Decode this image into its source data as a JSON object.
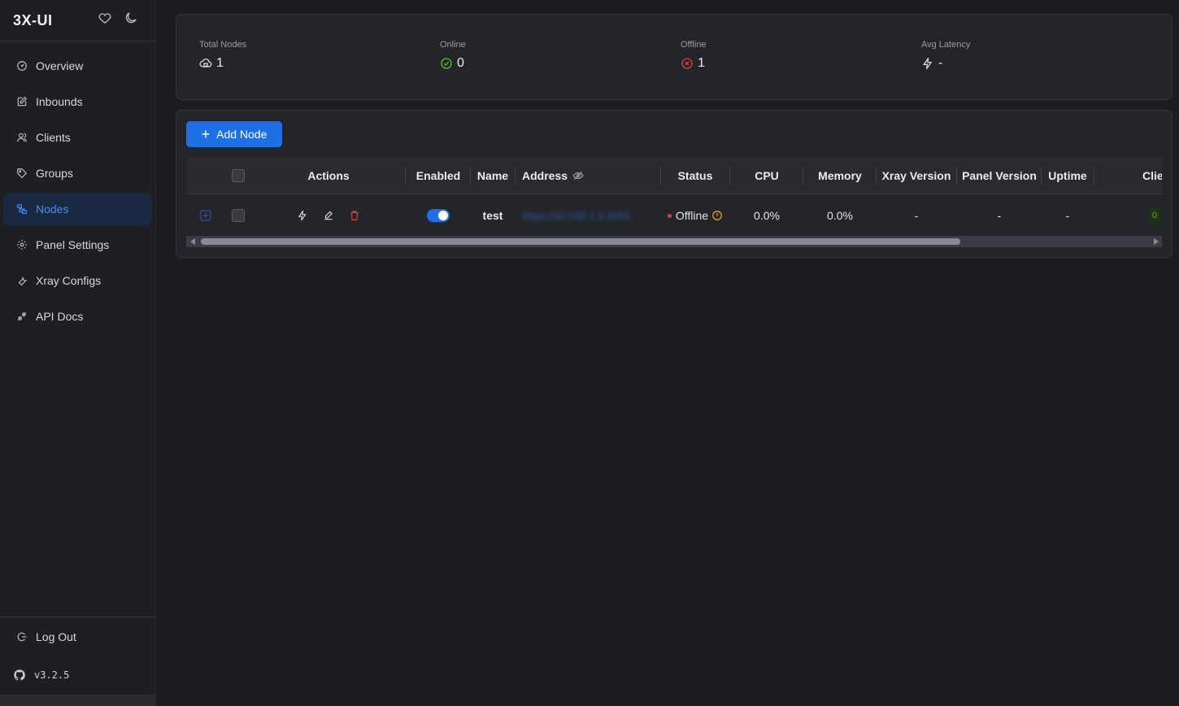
{
  "brand": {
    "title": "3X-UI",
    "heart_icon": "heart-icon",
    "theme_icon": "moon-icon"
  },
  "sidebar": {
    "items": [
      {
        "label": "Overview",
        "icon": "dashboard-icon",
        "active": false
      },
      {
        "label": "Inbounds",
        "icon": "edit-square-icon",
        "active": false
      },
      {
        "label": "Clients",
        "icon": "users-icon",
        "active": false
      },
      {
        "label": "Groups",
        "icon": "tag-icon",
        "active": false
      },
      {
        "label": "Nodes",
        "icon": "cluster-icon",
        "active": true
      },
      {
        "label": "Panel Settings",
        "icon": "gear-icon",
        "active": false
      },
      {
        "label": "Xray Configs",
        "icon": "wrench-icon",
        "active": false
      },
      {
        "label": "API Docs",
        "icon": "api-icon",
        "active": false
      }
    ],
    "logout_label": "Log Out",
    "version": "v3.2.5"
  },
  "stats": {
    "total_nodes": {
      "label": "Total Nodes",
      "value": "1"
    },
    "online": {
      "label": "Online",
      "value": "0"
    },
    "offline": {
      "label": "Offline",
      "value": "1"
    },
    "avg_latency": {
      "label": "Avg Latency",
      "value": "-"
    }
  },
  "nodes": {
    "add_button_label": "Add Node",
    "columns": {
      "actions": "Actions",
      "enabled": "Enabled",
      "name": "Name",
      "address": "Address",
      "status": "Status",
      "cpu": "CPU",
      "memory": "Memory",
      "xray_version": "Xray Version",
      "panel_version": "Panel Version",
      "uptime": "Uptime",
      "clients": "Clie"
    },
    "rows": [
      {
        "name": "test",
        "address": "https://10.100.1.1:2053",
        "status": "Offline",
        "cpu": "0.0%",
        "memory": "0.0%",
        "xray_version": "-",
        "panel_version": "-",
        "uptime": "-",
        "clients": "0"
      }
    ]
  },
  "colors": {
    "accent": "#1f6fe5",
    "online": "#52c41a",
    "offline": "#e0413d",
    "warning": "#faad14"
  }
}
